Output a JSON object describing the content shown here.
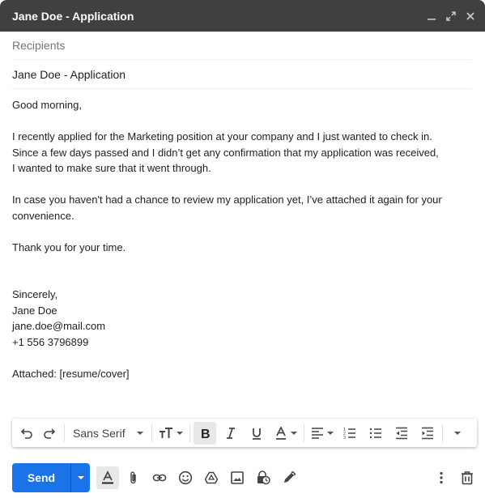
{
  "window": {
    "title": "Jane Doe - Application",
    "controls": [
      {
        "name": "minimize",
        "icon": "minimize-icon"
      },
      {
        "name": "expand",
        "icon": "expand-icon"
      },
      {
        "name": "close",
        "icon": "close-icon"
      }
    ]
  },
  "compose": {
    "recipients_placeholder": "Recipients",
    "recipients_value": "",
    "subject": "Jane Doe - Application",
    "body_lines": [
      "Good morning,",
      "",
      "I recently applied for the Marketing position at your company and I just wanted to check in.",
      "Since a few days passed and I didn’t get any confirmation that my application was received,",
      "I wanted to make sure that it went through.",
      "",
      "In case you haven't had a chance to review my application yet, I’ve attached it again for your",
      "convenience.",
      "",
      "Thank you for your time.",
      "",
      "",
      "Sincerely,",
      "Jane Doe",
      "jane.doe@mail.com",
      "+1 556 3796899",
      "",
      "Attached: [resume/cover]"
    ]
  },
  "format_toolbar": {
    "font": "Sans Serif",
    "items": [
      "undo",
      "redo",
      "font",
      "text-size",
      "bold",
      "italic",
      "underline",
      "text-color",
      "align",
      "numbered-list",
      "bulleted-list",
      "indent-less",
      "indent-more",
      "more-formatting"
    ],
    "bold_active": true
  },
  "bottom_bar": {
    "send_label": "Send",
    "icons": [
      "formatting-options",
      "attach-files",
      "insert-link",
      "insert-emoji",
      "insert-drive",
      "insert-photo",
      "confidential-mode",
      "insert-signature"
    ],
    "right_icons": [
      "more-options",
      "discard-draft"
    ],
    "accent_color": "#1a73e8"
  }
}
